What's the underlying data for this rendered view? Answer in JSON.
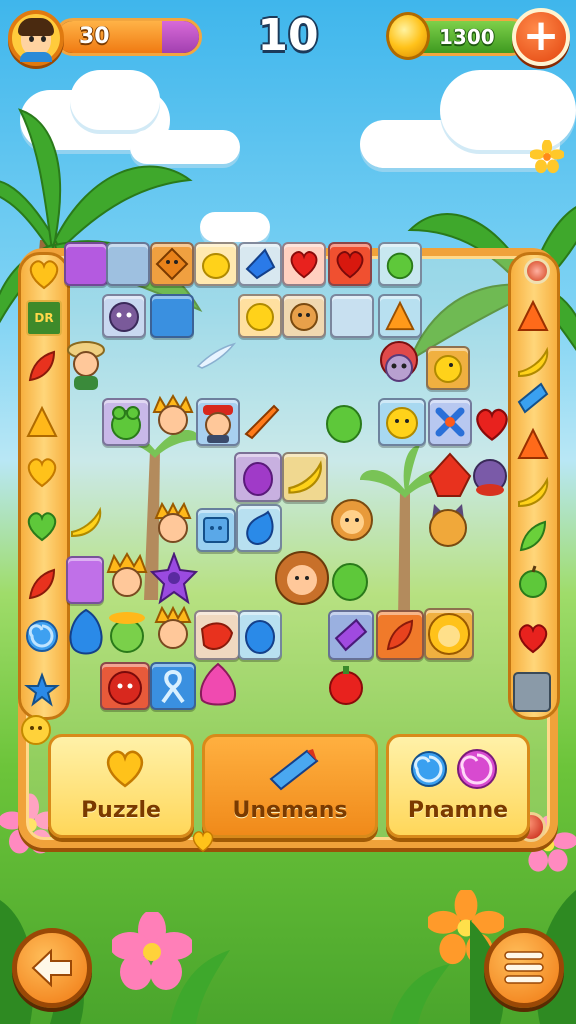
{
  "hud": {
    "lives": "30",
    "lives_fraction": 0.74,
    "level": "10",
    "coins": "1300",
    "plus_label": "+"
  },
  "power_buttons": [
    {
      "label": "Puzzle",
      "icon": "heart-icon"
    },
    {
      "label": "Unemans",
      "icon": "crystal-shard-icon"
    },
    {
      "label": "Pnamne",
      "icon": "swirl-candies-icon"
    }
  ],
  "navigation": {
    "back_icon": "arrow-left-icon",
    "menu_icon": "hamburger-menu-icon"
  },
  "left_rail_badge": "DR",
  "colors": {
    "accent_orange": "#f0a23a",
    "hud_orange": "#f07a12",
    "hud_purple": "#a240b0",
    "coin_green": "#3e9a20",
    "plus_red": "#e2440e"
  }
}
